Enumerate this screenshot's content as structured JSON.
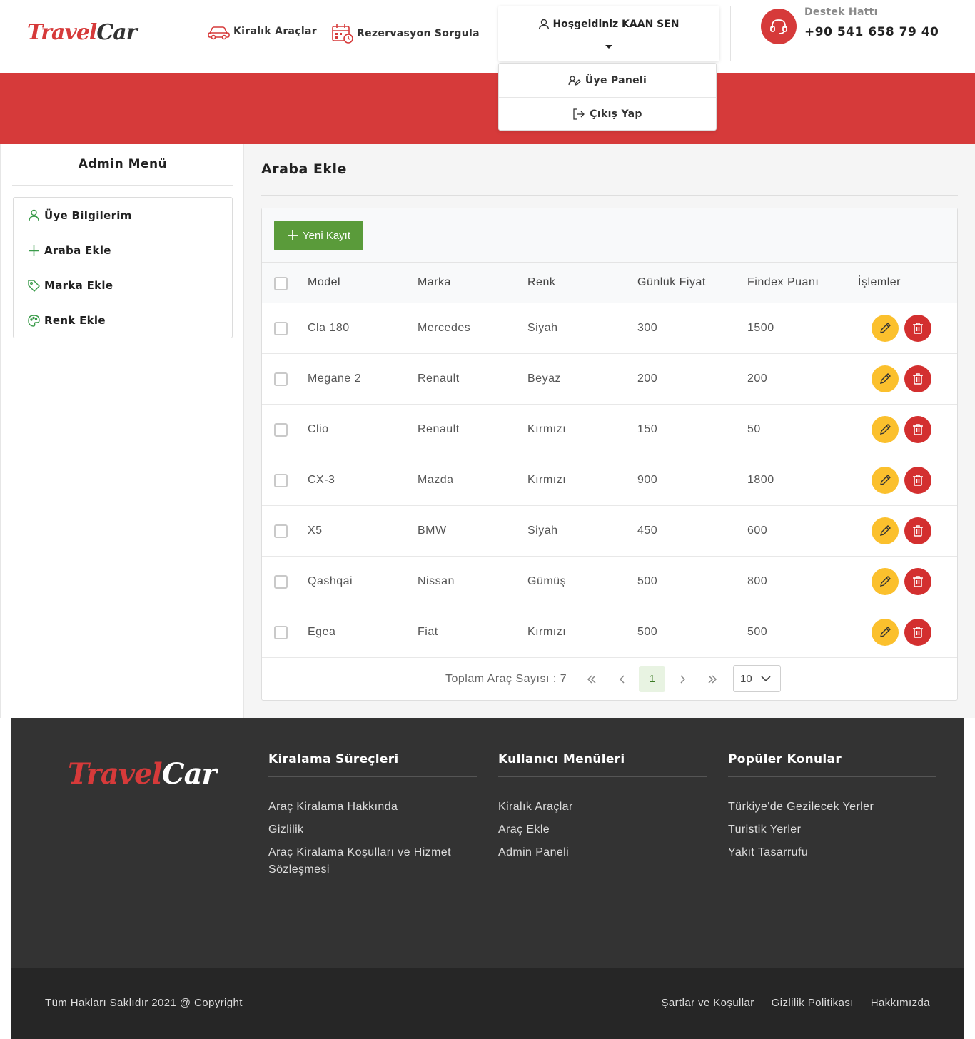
{
  "brand": {
    "part1": "Travel",
    "part2": "Car"
  },
  "nav": {
    "cars_label": "Kiralık Araçlar",
    "reservation_label": "Rezervasyon Sorgula"
  },
  "user": {
    "welcome": "Hoşgeldiniz KAAN SEN",
    "menu": [
      {
        "label": "Üye Paneli",
        "icon": "user-edit-icon"
      },
      {
        "label": "Çıkış Yap",
        "icon": "logout-icon"
      }
    ]
  },
  "support": {
    "label": "Destek Hattı",
    "phone": "+90 541 658 79 40"
  },
  "sidebar": {
    "title": "Admin Menü",
    "items": [
      {
        "label": "Üye Bilgilerim",
        "icon": "user-icon"
      },
      {
        "label": "Araba Ekle",
        "icon": "plus-icon"
      },
      {
        "label": "Marka Ekle",
        "icon": "tag-icon"
      },
      {
        "label": "Renk Ekle",
        "icon": "palette-icon"
      }
    ]
  },
  "main": {
    "title": "Araba Ekle",
    "new_button": "Yeni Kayıt",
    "columns": [
      "Model",
      "Marka",
      "Renk",
      "Günlük Fiyat",
      "Findex Puanı",
      "İşlemler"
    ],
    "rows": [
      [
        "Cla 180",
        "Mercedes",
        "Siyah",
        "300",
        "1500"
      ],
      [
        "Megane 2",
        "Renault",
        "Beyaz",
        "200",
        "200"
      ],
      [
        "Clio",
        "Renault",
        "Kırmızı",
        "150",
        "50"
      ],
      [
        "CX-3",
        "Mazda",
        "Kırmızı",
        "900",
        "1800"
      ],
      [
        "X5",
        "BMW",
        "Siyah",
        "450",
        "600"
      ],
      [
        "Qashqai",
        "Nissan",
        "Gümüş",
        "500",
        "800"
      ],
      [
        "Egea",
        "Fiat",
        "Kırmızı",
        "500",
        "500"
      ]
    ],
    "pagination": {
      "total_label": "Toplam Araç Sayısı : 7",
      "current_page": "1",
      "page_size": "10"
    }
  },
  "footer": {
    "columns": [
      {
        "title": "Kiralama Süreçleri",
        "links": [
          "Araç Kiralama Hakkında",
          "Gizlilik",
          "Araç Kiralama Koşulları ve Hizmet Sözleşmesi"
        ]
      },
      {
        "title": "Kullanıcı Menüleri",
        "links": [
          "Kiralık Araçlar",
          "Araç Ekle",
          "Admin Paneli"
        ]
      },
      {
        "title": "Popüler Konular",
        "links": [
          "Türkiye'de Gezilecek Yerler",
          "Turistik Yerler",
          "Yakıt Tasarrufu"
        ]
      }
    ],
    "copyright": "Tüm Hakları Saklıdır 2021 @ Copyright",
    "bottom_links": [
      "Şartlar ve Koşullar",
      "Gizlilik Politikası",
      "Hakkımızda"
    ]
  },
  "colors": {
    "brand_red": "#d63a3a",
    "green": "#5a9b3a",
    "edit_yellow": "#fbc02d",
    "delete_red": "#d32f2f",
    "footer_dark": "#333333"
  }
}
